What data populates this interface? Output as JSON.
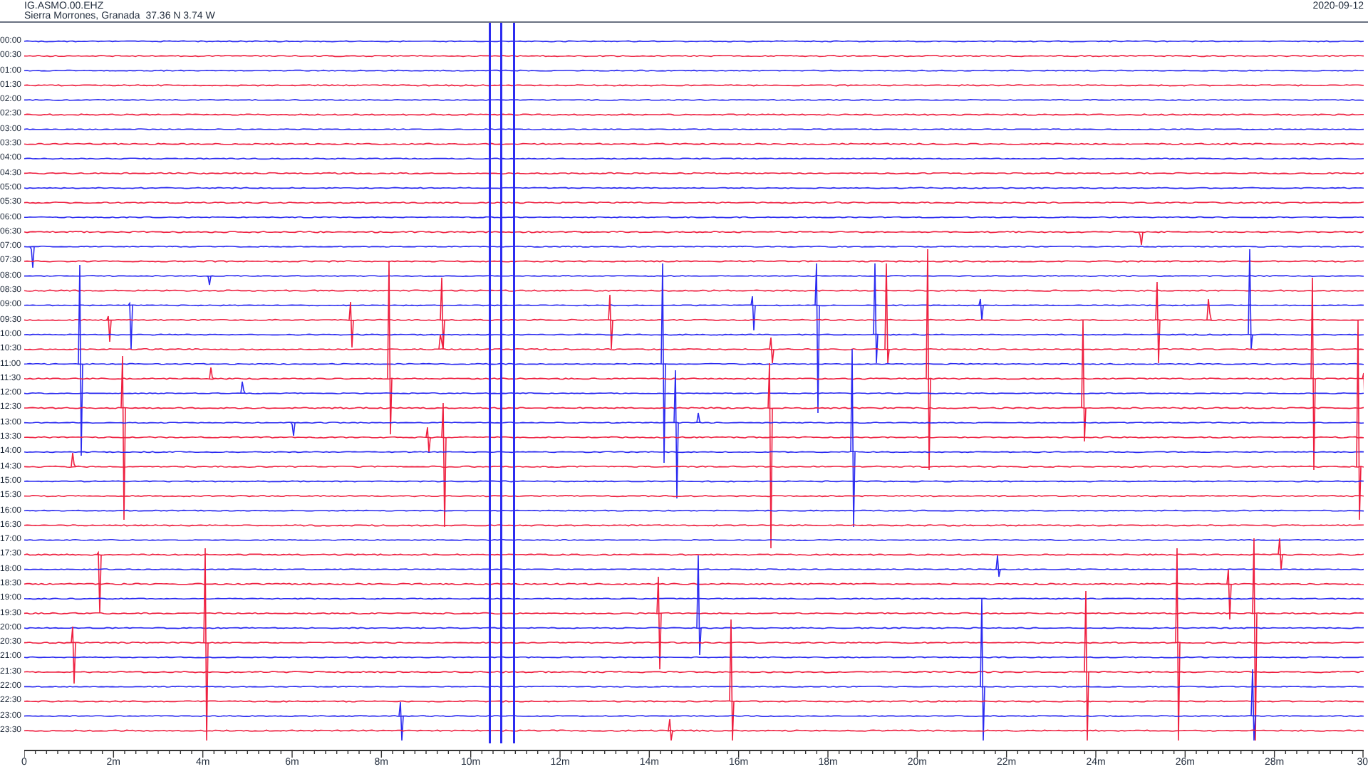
{
  "header": {
    "station": "IG.ASMO.00.EHZ",
    "location": "Sierra Morrones, Granada  37.36 N 3.74 W",
    "date": "2020-09-12"
  },
  "rows": [
    {
      "label": "00:00",
      "color": "#2b2bf0"
    },
    {
      "label": "00:30",
      "color": "#ee2040"
    },
    {
      "label": "01:00",
      "color": "#2b2bf0"
    },
    {
      "label": "01:30",
      "color": "#ee2040"
    },
    {
      "label": "02:00",
      "color": "#2b2bf0"
    },
    {
      "label": "02:30",
      "color": "#ee2040"
    },
    {
      "label": "03:00",
      "color": "#2b2bf0"
    },
    {
      "label": "03:30",
      "color": "#ee2040"
    },
    {
      "label": "04:00",
      "color": "#2b2bf0"
    },
    {
      "label": "04:30",
      "color": "#ee2040"
    },
    {
      "label": "05:00",
      "color": "#2b2bf0"
    },
    {
      "label": "05:30",
      "color": "#ee2040"
    },
    {
      "label": "06:00",
      "color": "#2b2bf0"
    },
    {
      "label": "06:30",
      "color": "#ee2040"
    },
    {
      "label": "07:00",
      "color": "#2b2bf0"
    },
    {
      "label": "07:30",
      "color": "#ee2040"
    },
    {
      "label": "08:00",
      "color": "#2b2bf0"
    },
    {
      "label": "08:30",
      "color": "#ee2040"
    },
    {
      "label": "09:00",
      "color": "#2b2bf0"
    },
    {
      "label": "09:30",
      "color": "#ee2040"
    },
    {
      "label": "10:00",
      "color": "#2b2bf0"
    },
    {
      "label": "10:30",
      "color": "#ee2040"
    },
    {
      "label": "11:00",
      "color": "#2b2bf0"
    },
    {
      "label": "11:30",
      "color": "#ee2040"
    },
    {
      "label": "12:00",
      "color": "#2b2bf0"
    },
    {
      "label": "12:30",
      "color": "#ee2040"
    },
    {
      "label": "13:00",
      "color": "#2b2bf0"
    },
    {
      "label": "13:30",
      "color": "#ee2040"
    },
    {
      "label": "14:00",
      "color": "#2b2bf0"
    },
    {
      "label": "14:30",
      "color": "#ee2040"
    },
    {
      "label": "15:00",
      "color": "#2b2bf0"
    },
    {
      "label": "15:30",
      "color": "#ee2040"
    },
    {
      "label": "16:00",
      "color": "#2b2bf0"
    },
    {
      "label": "16:30",
      "color": "#ee2040"
    },
    {
      "label": "17:00",
      "color": "#2b2bf0"
    },
    {
      "label": "17:30",
      "color": "#ee2040"
    },
    {
      "label": "18:00",
      "color": "#2b2bf0"
    },
    {
      "label": "18:30",
      "color": "#ee2040"
    },
    {
      "label": "19:00",
      "color": "#2b2bf0"
    },
    {
      "label": "19:30",
      "color": "#ee2040"
    },
    {
      "label": "20:00",
      "color": "#2b2bf0"
    },
    {
      "label": "20:30",
      "color": "#ee2040"
    },
    {
      "label": "21:00",
      "color": "#2b2bf0"
    },
    {
      "label": "21:30",
      "color": "#ee2040"
    },
    {
      "label": "22:00",
      "color": "#2b2bf0"
    },
    {
      "label": "22:30",
      "color": "#ee2040"
    },
    {
      "label": "23:00",
      "color": "#2b2bf0"
    },
    {
      "label": "23:30",
      "color": "#ee2040"
    }
  ],
  "x_ticks": [
    "0",
    "2m",
    "4m",
    "6m",
    "8m",
    "10m",
    "12m",
    "14m",
    "16m",
    "18m",
    "20m",
    "22m",
    "24m",
    "26m",
    "28m",
    "30"
  ]
}
